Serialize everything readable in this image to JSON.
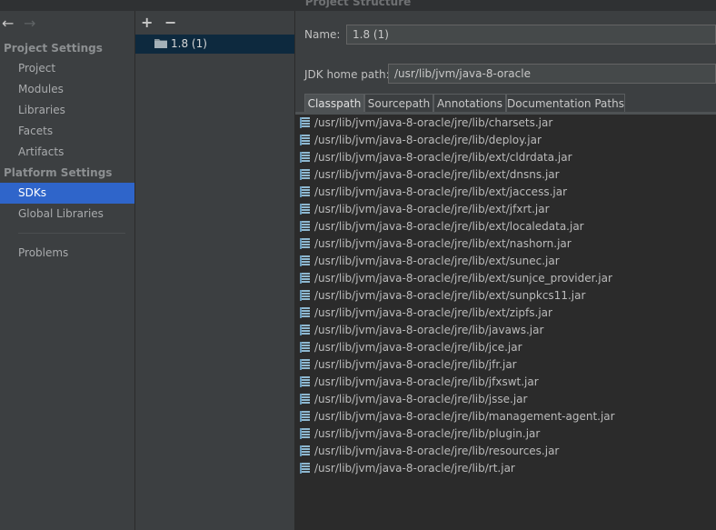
{
  "window": {
    "title": "Project Structure"
  },
  "nav": {
    "back_icon": "arrow-left-icon",
    "forward_icon": "arrow-right-icon",
    "sections": [
      {
        "title": "Project Settings",
        "items": [
          "Project",
          "Modules",
          "Libraries",
          "Facets",
          "Artifacts"
        ]
      },
      {
        "title": "Platform Settings",
        "items": [
          "SDKs",
          "Global Libraries"
        ]
      }
    ],
    "selected": "SDKs",
    "extra": "Problems"
  },
  "sdk_panel": {
    "add_label": "+",
    "remove_label": "−",
    "sdks": [
      {
        "label": "1.8 (1)",
        "icon": "folder-icon"
      }
    ]
  },
  "form": {
    "name_label": "Name:",
    "name_value": "1.8 (1)",
    "jdk_home_label": "JDK home path:",
    "jdk_home_value": "/usr/lib/jvm/java-8-oracle"
  },
  "tabs": [
    "Classpath",
    "Sourcepath",
    "Annotations",
    "Documentation Paths"
  ],
  "active_tab": "Classpath",
  "classpath": [
    "/usr/lib/jvm/java-8-oracle/jre/lib/charsets.jar",
    "/usr/lib/jvm/java-8-oracle/jre/lib/deploy.jar",
    "/usr/lib/jvm/java-8-oracle/jre/lib/ext/cldrdata.jar",
    "/usr/lib/jvm/java-8-oracle/jre/lib/ext/dnsns.jar",
    "/usr/lib/jvm/java-8-oracle/jre/lib/ext/jaccess.jar",
    "/usr/lib/jvm/java-8-oracle/jre/lib/ext/jfxrt.jar",
    "/usr/lib/jvm/java-8-oracle/jre/lib/ext/localedata.jar",
    "/usr/lib/jvm/java-8-oracle/jre/lib/ext/nashorn.jar",
    "/usr/lib/jvm/java-8-oracle/jre/lib/ext/sunec.jar",
    "/usr/lib/jvm/java-8-oracle/jre/lib/ext/sunjce_provider.jar",
    "/usr/lib/jvm/java-8-oracle/jre/lib/ext/sunpkcs11.jar",
    "/usr/lib/jvm/java-8-oracle/jre/lib/ext/zipfs.jar",
    "/usr/lib/jvm/java-8-oracle/jre/lib/javaws.jar",
    "/usr/lib/jvm/java-8-oracle/jre/lib/jce.jar",
    "/usr/lib/jvm/java-8-oracle/jre/lib/jfr.jar",
    "/usr/lib/jvm/java-8-oracle/jre/lib/jfxswt.jar",
    "/usr/lib/jvm/java-8-oracle/jre/lib/jsse.jar",
    "/usr/lib/jvm/java-8-oracle/jre/lib/management-agent.jar",
    "/usr/lib/jvm/java-8-oracle/jre/lib/plugin.jar",
    "/usr/lib/jvm/java-8-oracle/jre/lib/resources.jar",
    "/usr/lib/jvm/java-8-oracle/jre/lib/rt.jar"
  ],
  "colors": {
    "selection": "#2f65ca",
    "background": "#3c3f41",
    "list_background": "#2b2b2b"
  }
}
